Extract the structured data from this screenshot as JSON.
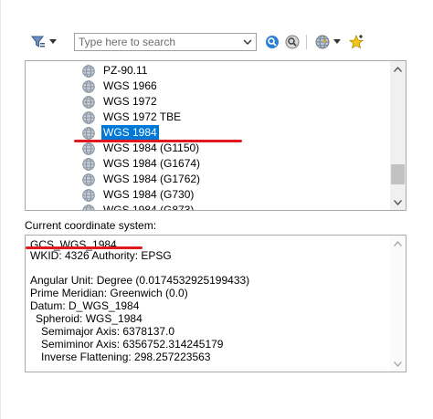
{
  "toolbar": {
    "filter_icon": "filter-icon",
    "search_placeholder": "Type here to search",
    "search_value": "",
    "search_button_icon": "search-icon",
    "clear_search_icon": "clear-search-icon",
    "globe_menu_icon": "globe-icon",
    "favorite_icon": "add-favorite-star-icon"
  },
  "tree": {
    "items": [
      {
        "label": "PZ-90.11",
        "selected": false
      },
      {
        "label": "WGS 1966",
        "selected": false
      },
      {
        "label": "WGS 1972",
        "selected": false
      },
      {
        "label": "WGS 1972 TBE",
        "selected": false
      },
      {
        "label": "WGS 1984",
        "selected": true
      },
      {
        "label": "WGS 1984 (G1150)",
        "selected": false
      },
      {
        "label": "WGS 1984 (G1674)",
        "selected": false
      },
      {
        "label": "WGS 1984 (G1762)",
        "selected": false
      },
      {
        "label": "WGS 1984 (G730)",
        "selected": false
      },
      {
        "label": "WGS 1984 (G873)",
        "selected": false
      }
    ],
    "item_icon": "globe-icon"
  },
  "current": {
    "label": "Current coordinate system:",
    "name": "GCS_WGS_1984",
    "wkid": "WKID: 4326 Authority: EPSG",
    "angular_unit": "Angular Unit: Degree (0.0174532925199433)",
    "prime_meridian": "Prime Meridian: Greenwich (0.0)",
    "datum": "Datum: D_WGS_1984",
    "spheroid": "Spheroid: WGS_1984",
    "semimajor": "Semimajor Axis: 6378137.0",
    "semiminor": "Semiminor Axis: 6356752.314245179",
    "inverse_flattening": "Inverse Flattening: 298.257223563"
  },
  "colors": {
    "selection": "#0078d7",
    "annotation_underline": "#e0191f"
  }
}
